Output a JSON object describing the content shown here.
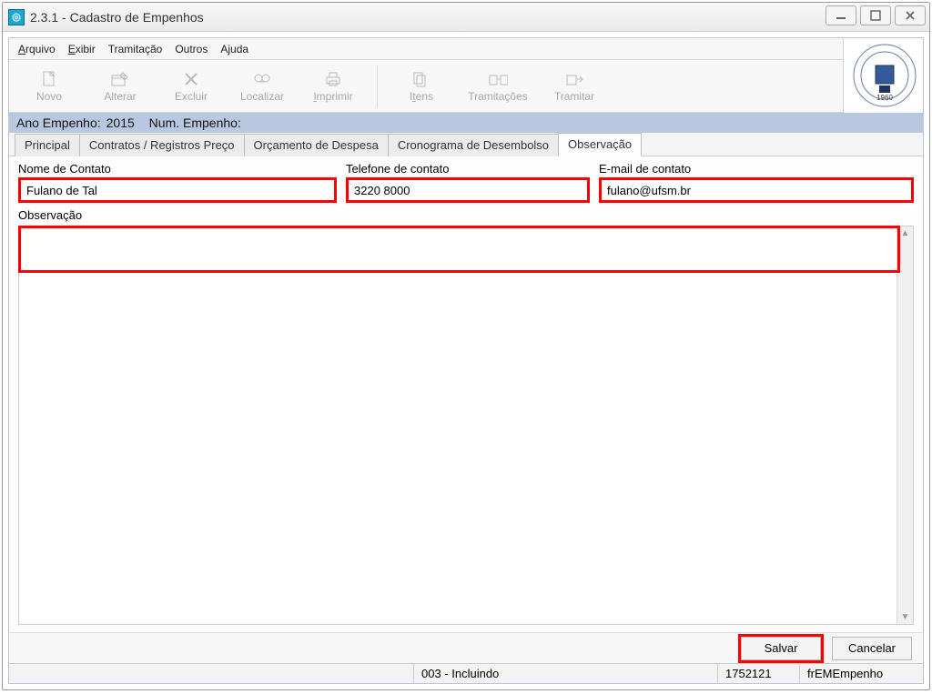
{
  "window": {
    "title": "2.3.1 - Cadastro de Empenhos"
  },
  "menu": {
    "arquivo": "Arquivo",
    "exibir": "Exibir",
    "tramitacao": "Tramitação",
    "outros": "Outros",
    "ajuda": "Ajuda"
  },
  "toolbar": {
    "novo": "Novo",
    "alterar": "Alterar",
    "excluir": "Excluir",
    "localizar": "Localizar",
    "imprimir": "Imprimir",
    "itens": "Itens",
    "tramitacoes": "Tramitações",
    "tramitar": "Tramitar"
  },
  "header": {
    "ano_label": "Ano Empenho:",
    "ano_value": "2015",
    "num_label": "Num. Empenho:",
    "num_value": ""
  },
  "tabs": {
    "principal": "Principal",
    "contratos": "Contratos / Registros Preço",
    "orcamento": "Orçamento de Despesa",
    "cronograma": "Cronograma de Desembolso",
    "observacao": "Observação"
  },
  "fields": {
    "nome_label": "Nome de Contato",
    "nome_value": "Fulano de Tal",
    "tel_label": "Telefone de contato",
    "tel_value": "3220 8000",
    "email_label": "E-mail de contato",
    "email_value": "fulano@ufsm.br",
    "obs_label": "Observação",
    "obs_value": ""
  },
  "buttons": {
    "salvar": "Salvar",
    "cancelar": "Cancelar"
  },
  "status": {
    "mode": "003 - Incluindo",
    "code": "1752121",
    "form": "frEMEmpenho"
  },
  "logo": {
    "year": "1960"
  }
}
